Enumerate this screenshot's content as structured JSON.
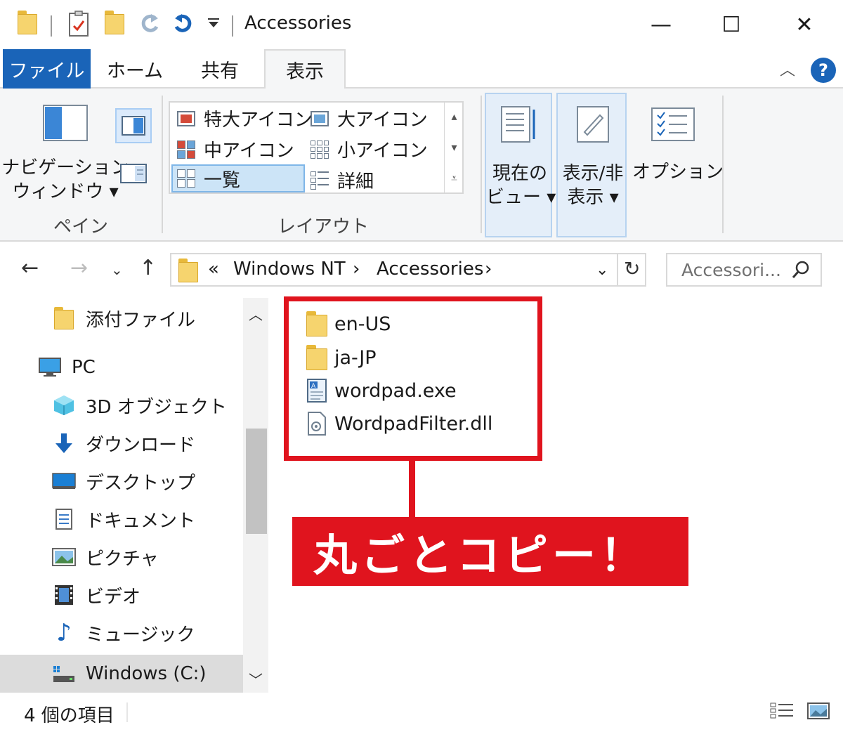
{
  "window": {
    "title": "Accessories",
    "minimize_glyph": "—",
    "maximize_glyph": "☐",
    "close_glyph": "✕"
  },
  "ribbon_tabs": [
    {
      "label": "ファイル",
      "state": "file"
    },
    {
      "label": "ホーム",
      "state": "normal"
    },
    {
      "label": "共有",
      "state": "normal"
    },
    {
      "label": "表示",
      "state": "active"
    }
  ],
  "ribbon": {
    "pane_group": {
      "nav_pane_line1": "ナビゲーション",
      "nav_pane_line2": "ウィンドウ ▾",
      "label": "ペイン"
    },
    "layout_group": {
      "items": [
        "特大アイコン",
        "大アイコン",
        "中アイコン",
        "小アイコン",
        "一覧",
        "詳細"
      ],
      "selected": "一覧",
      "label": "レイアウト"
    },
    "current_view": {
      "line1": "現在の",
      "line2": "ビュー ▾"
    },
    "show_hide": {
      "line1": "表示/非",
      "line2": "表示 ▾"
    },
    "options": {
      "label": "オプション"
    }
  },
  "address_bar": {
    "overflow": "«",
    "segments": [
      "Windows NT",
      "Accessories"
    ],
    "separator": "›",
    "search_placeholder": "Accessori..."
  },
  "nav_pane": {
    "items": [
      {
        "label": "添付ファイル",
        "icon": "folder-icon"
      },
      {
        "label": "PC",
        "icon": "pc-icon"
      },
      {
        "label": "3D オブジェクト",
        "icon": "3d-objects-icon"
      },
      {
        "label": "ダウンロード",
        "icon": "download-icon"
      },
      {
        "label": "デスクトップ",
        "icon": "desktop-icon"
      },
      {
        "label": "ドキュメント",
        "icon": "documents-icon"
      },
      {
        "label": "ピクチャ",
        "icon": "pictures-icon"
      },
      {
        "label": "ビデオ",
        "icon": "videos-icon"
      },
      {
        "label": "ミュージック",
        "icon": "music-icon"
      },
      {
        "label": "Windows (C:)",
        "icon": "drive-icon"
      }
    ],
    "selected": "Windows (C:)"
  },
  "files": [
    {
      "name": "en-US",
      "type": "folder"
    },
    {
      "name": "ja-JP",
      "type": "folder"
    },
    {
      "name": "wordpad.exe",
      "type": "exe"
    },
    {
      "name": "WordpadFilter.dll",
      "type": "dll"
    }
  ],
  "annotation": {
    "text": "丸ごとコピー！",
    "color": "#e0141e"
  },
  "status_bar": {
    "item_count": "4 個の項目"
  },
  "colors": {
    "accent": "#1a64b8",
    "folder": "#f6d46e",
    "selection": "#dbeafb"
  }
}
